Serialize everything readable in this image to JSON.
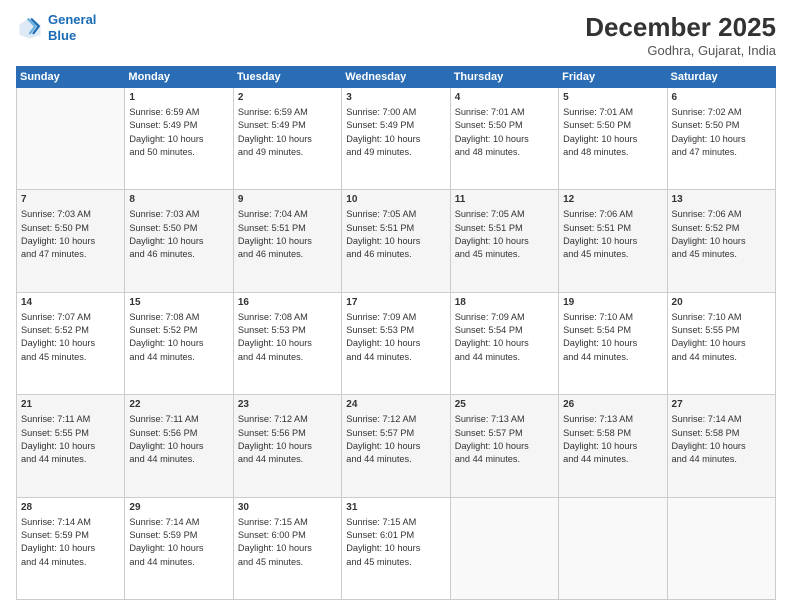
{
  "header": {
    "logo_line1": "General",
    "logo_line2": "Blue",
    "title": "December 2025",
    "subtitle": "Godhra, Gujarat, India"
  },
  "weekdays": [
    "Sunday",
    "Monday",
    "Tuesday",
    "Wednesday",
    "Thursday",
    "Friday",
    "Saturday"
  ],
  "weeks": [
    [
      {
        "day": "",
        "info": ""
      },
      {
        "day": "1",
        "info": "Sunrise: 6:59 AM\nSunset: 5:49 PM\nDaylight: 10 hours\nand 50 minutes."
      },
      {
        "day": "2",
        "info": "Sunrise: 6:59 AM\nSunset: 5:49 PM\nDaylight: 10 hours\nand 49 minutes."
      },
      {
        "day": "3",
        "info": "Sunrise: 7:00 AM\nSunset: 5:49 PM\nDaylight: 10 hours\nand 49 minutes."
      },
      {
        "day": "4",
        "info": "Sunrise: 7:01 AM\nSunset: 5:50 PM\nDaylight: 10 hours\nand 48 minutes."
      },
      {
        "day": "5",
        "info": "Sunrise: 7:01 AM\nSunset: 5:50 PM\nDaylight: 10 hours\nand 48 minutes."
      },
      {
        "day": "6",
        "info": "Sunrise: 7:02 AM\nSunset: 5:50 PM\nDaylight: 10 hours\nand 47 minutes."
      }
    ],
    [
      {
        "day": "7",
        "info": "Sunrise: 7:03 AM\nSunset: 5:50 PM\nDaylight: 10 hours\nand 47 minutes."
      },
      {
        "day": "8",
        "info": "Sunrise: 7:03 AM\nSunset: 5:50 PM\nDaylight: 10 hours\nand 46 minutes."
      },
      {
        "day": "9",
        "info": "Sunrise: 7:04 AM\nSunset: 5:51 PM\nDaylight: 10 hours\nand 46 minutes."
      },
      {
        "day": "10",
        "info": "Sunrise: 7:05 AM\nSunset: 5:51 PM\nDaylight: 10 hours\nand 46 minutes."
      },
      {
        "day": "11",
        "info": "Sunrise: 7:05 AM\nSunset: 5:51 PM\nDaylight: 10 hours\nand 45 minutes."
      },
      {
        "day": "12",
        "info": "Sunrise: 7:06 AM\nSunset: 5:51 PM\nDaylight: 10 hours\nand 45 minutes."
      },
      {
        "day": "13",
        "info": "Sunrise: 7:06 AM\nSunset: 5:52 PM\nDaylight: 10 hours\nand 45 minutes."
      }
    ],
    [
      {
        "day": "14",
        "info": "Sunrise: 7:07 AM\nSunset: 5:52 PM\nDaylight: 10 hours\nand 45 minutes."
      },
      {
        "day": "15",
        "info": "Sunrise: 7:08 AM\nSunset: 5:52 PM\nDaylight: 10 hours\nand 44 minutes."
      },
      {
        "day": "16",
        "info": "Sunrise: 7:08 AM\nSunset: 5:53 PM\nDaylight: 10 hours\nand 44 minutes."
      },
      {
        "day": "17",
        "info": "Sunrise: 7:09 AM\nSunset: 5:53 PM\nDaylight: 10 hours\nand 44 minutes."
      },
      {
        "day": "18",
        "info": "Sunrise: 7:09 AM\nSunset: 5:54 PM\nDaylight: 10 hours\nand 44 minutes."
      },
      {
        "day": "19",
        "info": "Sunrise: 7:10 AM\nSunset: 5:54 PM\nDaylight: 10 hours\nand 44 minutes."
      },
      {
        "day": "20",
        "info": "Sunrise: 7:10 AM\nSunset: 5:55 PM\nDaylight: 10 hours\nand 44 minutes."
      }
    ],
    [
      {
        "day": "21",
        "info": "Sunrise: 7:11 AM\nSunset: 5:55 PM\nDaylight: 10 hours\nand 44 minutes."
      },
      {
        "day": "22",
        "info": "Sunrise: 7:11 AM\nSunset: 5:56 PM\nDaylight: 10 hours\nand 44 minutes."
      },
      {
        "day": "23",
        "info": "Sunrise: 7:12 AM\nSunset: 5:56 PM\nDaylight: 10 hours\nand 44 minutes."
      },
      {
        "day": "24",
        "info": "Sunrise: 7:12 AM\nSunset: 5:57 PM\nDaylight: 10 hours\nand 44 minutes."
      },
      {
        "day": "25",
        "info": "Sunrise: 7:13 AM\nSunset: 5:57 PM\nDaylight: 10 hours\nand 44 minutes."
      },
      {
        "day": "26",
        "info": "Sunrise: 7:13 AM\nSunset: 5:58 PM\nDaylight: 10 hours\nand 44 minutes."
      },
      {
        "day": "27",
        "info": "Sunrise: 7:14 AM\nSunset: 5:58 PM\nDaylight: 10 hours\nand 44 minutes."
      }
    ],
    [
      {
        "day": "28",
        "info": "Sunrise: 7:14 AM\nSunset: 5:59 PM\nDaylight: 10 hours\nand 44 minutes."
      },
      {
        "day": "29",
        "info": "Sunrise: 7:14 AM\nSunset: 5:59 PM\nDaylight: 10 hours\nand 44 minutes."
      },
      {
        "day": "30",
        "info": "Sunrise: 7:15 AM\nSunset: 6:00 PM\nDaylight: 10 hours\nand 45 minutes."
      },
      {
        "day": "31",
        "info": "Sunrise: 7:15 AM\nSunset: 6:01 PM\nDaylight: 10 hours\nand 45 minutes."
      },
      {
        "day": "",
        "info": ""
      },
      {
        "day": "",
        "info": ""
      },
      {
        "day": "",
        "info": ""
      }
    ]
  ]
}
